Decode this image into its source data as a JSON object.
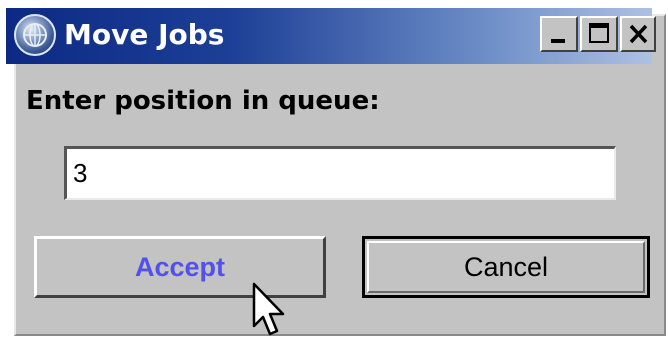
{
  "window": {
    "title": "Move Jobs",
    "app_icon": "globe-gear-icon",
    "controls": {
      "minimize": "minimize-icon",
      "maximize": "maximize-icon",
      "close": "close-icon"
    }
  },
  "dialog": {
    "prompt_label": "Enter position in queue:",
    "position_value": "3",
    "accept_label": "Accept",
    "cancel_label": "Cancel"
  },
  "colors": {
    "titlebar_start": "#0c2a84",
    "titlebar_end": "#aec1e4",
    "face": "#c3c3c3",
    "accept_text": "#5252ea"
  },
  "cursor": "arrow-pointer-icon"
}
